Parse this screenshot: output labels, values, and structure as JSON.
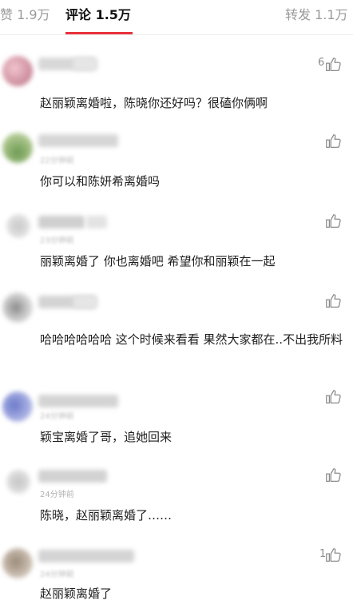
{
  "tabs": {
    "likes": "赞 1.9万",
    "comments": "评论 1.5万",
    "reposts": "转发 1.1万"
  },
  "colors": {
    "accent": "#e8333c",
    "muted": "#9a9a9a"
  },
  "comments": [
    {
      "text": "赵丽颖离婚啦，陈晓你还好吗？很磕你俩啊",
      "likes": "6",
      "time": ""
    },
    {
      "text": "你可以和陈妍希离婚吗",
      "likes": "",
      "time": "22分钟前"
    },
    {
      "text": "丽颖离婚了 你也离婚吧 希望你和丽颖在一起",
      "likes": "",
      "time": "23分钟前"
    },
    {
      "text": "哈哈哈哈哈哈  这个时候来看看  果然大家都在..不出我所料",
      "likes": "",
      "time": ""
    },
    {
      "text": "颖宝离婚了哥，追她回来",
      "likes": "",
      "time": "24分钟前"
    },
    {
      "text": "陈晓，赵丽颖离婚了……",
      "likes": "",
      "time": "24分钟前"
    },
    {
      "text": "赵丽颖离婚了",
      "likes": "1",
      "time": "24分钟前"
    }
  ],
  "icons": {
    "like": "thumbs-up-icon"
  }
}
